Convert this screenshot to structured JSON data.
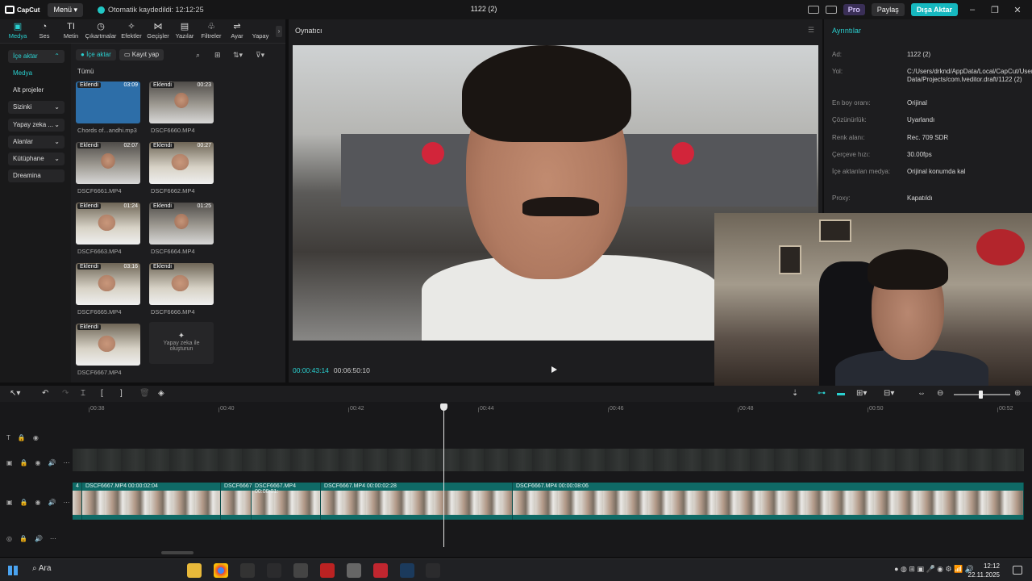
{
  "app": {
    "logo": "CapCut",
    "menu": "Menü",
    "autosave": "Otomatik kaydedildi: 12:12:25",
    "title": "1122 (2)",
    "pro": "Pro",
    "share": "Paylaş",
    "export": "Dışa Aktar"
  },
  "tools": [
    {
      "label": "Medya",
      "icon": "▣",
      "active": true
    },
    {
      "label": "Ses",
      "icon": "◔"
    },
    {
      "label": "Metin",
      "icon": "TI"
    },
    {
      "label": "Çıkartmalar",
      "icon": "◷"
    },
    {
      "label": "Efektler",
      "icon": "✧"
    },
    {
      "label": "Geçişler",
      "icon": "⋈"
    },
    {
      "label": "Yazılar",
      "icon": "▤"
    },
    {
      "label": "Filtreler",
      "icon": "♧"
    },
    {
      "label": "Ayar",
      "icon": "⇌"
    },
    {
      "label": "Yapay",
      "icon": ""
    }
  ],
  "nav": {
    "import": "İçe aktar",
    "media": "Medya",
    "subprojects": "Alt projeler",
    "yours": "Sizinki",
    "ai": "Yapay zeka ...",
    "spaces": "Alanlar",
    "library": "Kütüphane",
    "dreamina": "Dreamina"
  },
  "media_panel": {
    "import_btn": "İçe aktar",
    "record_btn": "Kayıt yap",
    "all": "Tümü",
    "added": "Eklendi",
    "ai_generate": "Yapay zeka ile oluşturun",
    "items": [
      {
        "name": "Chords of...andhi.mp3",
        "duration": "03:09"
      },
      {
        "name": "DSCF6660.MP4",
        "duration": "00:23"
      },
      {
        "name": "DSCF6661.MP4",
        "duration": "02:07"
      },
      {
        "name": "DSCF6662.MP4",
        "duration": "00:27"
      },
      {
        "name": "DSCF6663.MP4",
        "duration": "01:24"
      },
      {
        "name": "DSCF6664.MP4",
        "duration": "01:25"
      },
      {
        "name": "DSCF6665.MP4",
        "duration": "03:16"
      },
      {
        "name": "DSCF6666.MP4",
        "duration": ""
      },
      {
        "name": "DSCF6667.MP4",
        "duration": ""
      }
    ]
  },
  "player": {
    "title": "Oynatıcı",
    "current": "00:00:43:14",
    "total": "00:06:50:10"
  },
  "details": {
    "title": "Ayrıntılar",
    "rows": [
      {
        "k": "Ad:",
        "v": "1122 (2)"
      },
      {
        "k": "Yol:",
        "v": "C:/Users/drknd/AppData/Local/CapCut/User Data/Projects/com.lveditor.draft/1122 (2)"
      },
      {
        "k": "En boy oranı:",
        "v": "Orijinal"
      },
      {
        "k": "Çözünürlük:",
        "v": "Uyarlandı"
      },
      {
        "k": "Renk alanı:",
        "v": "Rec. 709 SDR"
      },
      {
        "k": "Çerçeve hızı:",
        "v": "30.00fps"
      },
      {
        "k": "İçe aktarılan medya:",
        "v": "Orijinal konumda kal"
      },
      {
        "k": "Proxy:",
        "v": "Kapatıldı"
      }
    ]
  },
  "ruler": [
    "00:38",
    "00:40",
    "00:42",
    "00:44",
    "00:46",
    "00:48",
    "00:50",
    "00:52"
  ],
  "clips": [
    {
      "label": "4",
      "w": 12
    },
    {
      "label": "DSCF6667.MP4  00:00:02:04",
      "w": 172
    },
    {
      "label": "DSCF6667",
      "w": 38
    },
    {
      "label": "DSCF6667.MP4  00:00:01:",
      "w": 86
    },
    {
      "label": "DSCF6667.MP4  00:00:02:28",
      "w": 238
    },
    {
      "label": "DSCF6667.MP4  00:00:08:06",
      "w": 634
    }
  ],
  "taskbar": {
    "search": "Ara",
    "time": "12:12",
    "date": "22.11.2025"
  }
}
